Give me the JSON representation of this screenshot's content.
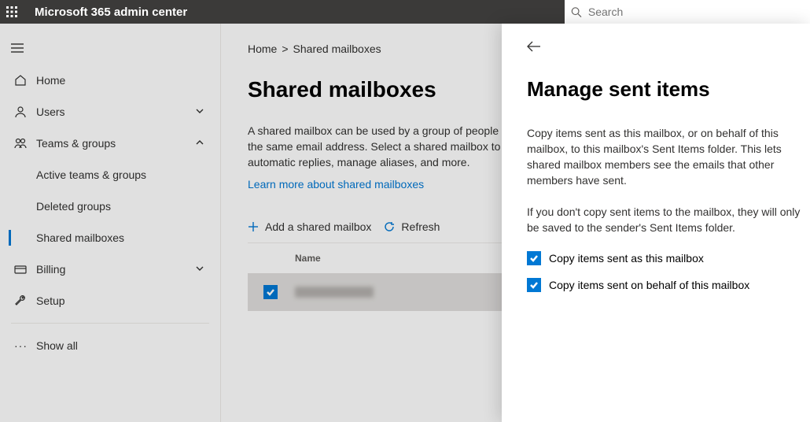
{
  "header": {
    "brand": "Microsoft 365 admin center",
    "search_placeholder": "Search"
  },
  "sidebar": {
    "items": [
      {
        "label": "Home"
      },
      {
        "label": "Users"
      },
      {
        "label": "Teams & groups"
      },
      {
        "label": "Active teams & groups"
      },
      {
        "label": "Deleted groups"
      },
      {
        "label": "Shared mailboxes"
      },
      {
        "label": "Billing"
      },
      {
        "label": "Setup"
      },
      {
        "label": "Show all"
      }
    ]
  },
  "breadcrumb": {
    "home": "Home",
    "current": "Shared mailboxes"
  },
  "main": {
    "title": "Shared mailboxes",
    "desc": "A shared mailbox can be used by a group of people to send and receive email from the same email address. Select a shared mailbox to edit members, set up automatic replies, manage aliases, and more.",
    "learn": "Learn more about shared mailboxes",
    "toolbar": {
      "add": "Add a shared mailbox",
      "refresh": "Refresh"
    },
    "columns": {
      "name": "Name"
    }
  },
  "panel": {
    "title": "Manage sent items",
    "p1": "Copy items sent as this mailbox, or on behalf of this mailbox, to this mailbox's Sent Items folder. This lets shared mailbox members see the emails that other members have sent.",
    "p2": "If you don't copy sent items to the mailbox, they will only be saved to the sender's Sent Items folder.",
    "opt1": "Copy items sent as this mailbox",
    "opt2": "Copy items sent on behalf of this mailbox"
  }
}
